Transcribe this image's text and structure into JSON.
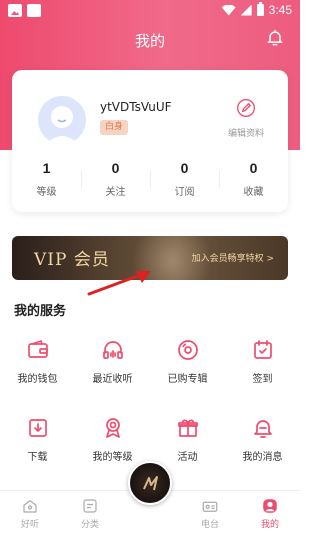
{
  "status_bar": {
    "time": "3:45"
  },
  "header": {
    "title": "我的"
  },
  "profile": {
    "username": "ytVDTsVuUF",
    "badge": "白身",
    "edit_label": "编辑资料",
    "stats": [
      {
        "value": "1",
        "label": "等级"
      },
      {
        "value": "0",
        "label": "关注"
      },
      {
        "value": "0",
        "label": "订阅"
      },
      {
        "value": "0",
        "label": "收藏"
      }
    ]
  },
  "vip": {
    "title": "VIP 会员",
    "link": "加入会员畅享特权 >"
  },
  "services": {
    "title": "我的服务",
    "items": [
      {
        "label": "我的钱包",
        "icon": "wallet-icon"
      },
      {
        "label": "最近收听",
        "icon": "headphones-icon"
      },
      {
        "label": "已购专辑",
        "icon": "disc-icon"
      },
      {
        "label": "签到",
        "icon": "calendar-check-icon"
      },
      {
        "label": "下载",
        "icon": "download-icon"
      },
      {
        "label": "我的等级",
        "icon": "medal-icon"
      },
      {
        "label": "活动",
        "icon": "gift-icon"
      },
      {
        "label": "我的消息",
        "icon": "bell-message-icon"
      }
    ]
  },
  "tabbar": {
    "items": [
      {
        "label": "好听",
        "icon": "home-icon",
        "active": false
      },
      {
        "label": "分类",
        "icon": "category-icon",
        "active": false
      },
      {
        "label": "电台",
        "icon": "radio-icon",
        "active": false
      },
      {
        "label": "我的",
        "icon": "profile-icon",
        "active": true
      }
    ]
  },
  "colors": {
    "accent": "#ef4d6f",
    "vip_gold": "#f3d6a4",
    "badge_bg": "#f6d3c2"
  }
}
